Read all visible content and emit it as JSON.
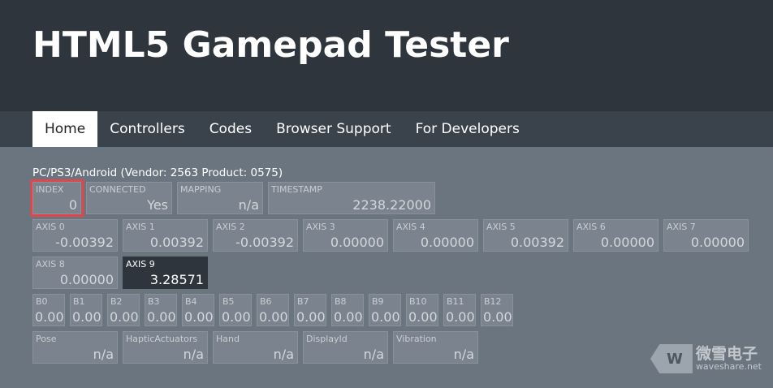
{
  "title": "HTML5 Gamepad Tester",
  "nav": [
    "Home",
    "Controllers",
    "Codes",
    "Browser Support",
    "For Developers"
  ],
  "device_name": "PC/PS3/Android (Vendor: 2563 Product: 0575)",
  "info": {
    "index": {
      "label": "INDEX",
      "value": "0"
    },
    "connected": {
      "label": "CONNECTED",
      "value": "Yes"
    },
    "mapping": {
      "label": "MAPPING",
      "value": "n/a"
    },
    "timestamp": {
      "label": "TIMESTAMP",
      "value": "2238.22000"
    }
  },
  "axes": [
    {
      "label": "AXIS 0",
      "value": "-0.00392"
    },
    {
      "label": "AXIS 1",
      "value": "0.00392"
    },
    {
      "label": "AXIS 2",
      "value": "-0.00392"
    },
    {
      "label": "AXIS 3",
      "value": "0.00000"
    },
    {
      "label": "AXIS 4",
      "value": "0.00000"
    },
    {
      "label": "AXIS 5",
      "value": "0.00392"
    },
    {
      "label": "AXIS 6",
      "value": "0.00000"
    },
    {
      "label": "AXIS 7",
      "value": "0.00000"
    },
    {
      "label": "AXIS 8",
      "value": "0.00000"
    },
    {
      "label": "AXIS 9",
      "value": "3.28571"
    }
  ],
  "buttons": [
    {
      "label": "B0",
      "value": "0.00"
    },
    {
      "label": "B1",
      "value": "0.00"
    },
    {
      "label": "B2",
      "value": "0.00"
    },
    {
      "label": "B3",
      "value": "0.00"
    },
    {
      "label": "B4",
      "value": "0.00"
    },
    {
      "label": "B5",
      "value": "0.00"
    },
    {
      "label": "B6",
      "value": "0.00"
    },
    {
      "label": "B7",
      "value": "0.00"
    },
    {
      "label": "B8",
      "value": "0.00"
    },
    {
      "label": "B9",
      "value": "0.00"
    },
    {
      "label": "B10",
      "value": "0.00"
    },
    {
      "label": "B11",
      "value": "0.00"
    },
    {
      "label": "B12",
      "value": "0.00"
    }
  ],
  "extras": [
    {
      "label": "Pose",
      "value": "n/a"
    },
    {
      "label": "HapticActuators",
      "value": "n/a"
    },
    {
      "label": "Hand",
      "value": "n/a"
    },
    {
      "label": "DisplayId",
      "value": "n/a"
    },
    {
      "label": "Vibration",
      "value": "n/a"
    }
  ],
  "watermark": {
    "logo": "W",
    "cn": "微雪电子",
    "en": "waveshare.net"
  },
  "colors": {
    "header_bg": "#2f353d",
    "nav_bg": "#3a424c",
    "page_bg": "#6b7580",
    "active_axis_bg": "#2f353d",
    "highlight": "#e0474c"
  }
}
